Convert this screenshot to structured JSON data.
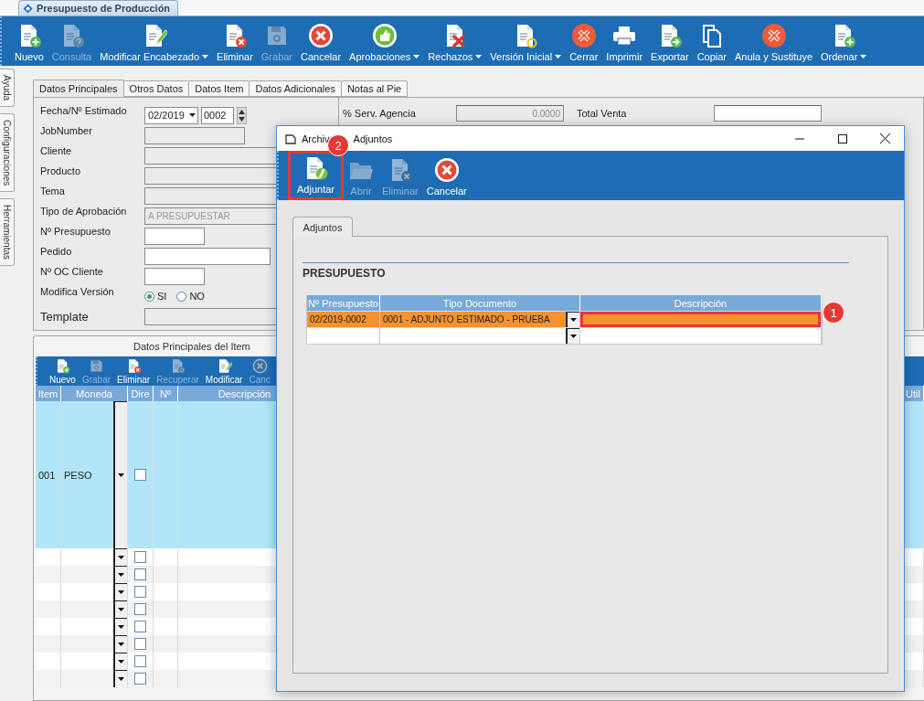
{
  "document_tab": {
    "title": "Presupuesto de Producción"
  },
  "toolbar": [
    {
      "label": "Nuevo",
      "disabled": false,
      "dropdown": false
    },
    {
      "label": "Consulta",
      "disabled": true,
      "dropdown": false
    },
    {
      "label": "Modificar Encabezado",
      "disabled": false,
      "dropdown": true
    },
    {
      "label": "Eliminar",
      "disabled": false,
      "dropdown": false
    },
    {
      "label": "Grabar",
      "disabled": true,
      "dropdown": false
    },
    {
      "label": "Cancelar",
      "disabled": false,
      "dropdown": false
    },
    {
      "label": "Aprobaciones",
      "disabled": false,
      "dropdown": true
    },
    {
      "label": "Rechazos",
      "disabled": false,
      "dropdown": true
    },
    {
      "label": "Versión Inicial",
      "disabled": false,
      "dropdown": true
    },
    {
      "label": "Cerrar",
      "disabled": false,
      "dropdown": false
    },
    {
      "label": "Imprimir",
      "disabled": false,
      "dropdown": false
    },
    {
      "label": "Exportar",
      "disabled": false,
      "dropdown": false
    },
    {
      "label": "Copiar",
      "disabled": false,
      "dropdown": false
    },
    {
      "label": "Anula y Sustituye",
      "disabled": false,
      "dropdown": false
    },
    {
      "label": "Ordenar",
      "disabled": false,
      "dropdown": true
    }
  ],
  "side_tabs": [
    "Ayuda",
    "Configuraciones",
    "Herramientas"
  ],
  "form_tabs": [
    {
      "label": "Datos Principales",
      "selected": true
    },
    {
      "label": "Otros Datos",
      "selected": false
    },
    {
      "label": "Datos Item",
      "selected": false
    },
    {
      "label": "Datos Adicionales",
      "selected": false
    },
    {
      "label": "Notas al Pie",
      "selected": false
    }
  ],
  "form": {
    "fields": [
      {
        "kind": "date",
        "label": "Fecha/Nº Estimado",
        "period": "02/2019",
        "number": "0002"
      },
      {
        "kind": "text",
        "label": "JobNumber",
        "disabled": true
      },
      {
        "kind": "text",
        "label": "Cliente",
        "disabled": true
      },
      {
        "kind": "text",
        "label": "Producto",
        "disabled": true
      },
      {
        "kind": "text",
        "label": "Tema",
        "disabled": true
      },
      {
        "kind": "text",
        "label": "Tipo de Aprobación",
        "value": "A PRESUPUESTAR",
        "disabled": true
      },
      {
        "kind": "text",
        "label": "Nº Presupuesto",
        "disabled": false
      },
      {
        "kind": "text",
        "label": "Pedido",
        "disabled": false
      },
      {
        "kind": "text",
        "label": "Nº OC Cliente",
        "disabled": false
      },
      {
        "kind": "radio",
        "label": "Modifica Versión",
        "options": [
          {
            "label": "SI",
            "selected": true
          },
          {
            "label": "NO",
            "selected": false
          }
        ]
      },
      {
        "kind": "text",
        "label": "Template",
        "disabled": true
      }
    ],
    "totals": [
      {
        "label": "% Serv. Agencia",
        "value": "0.0000",
        "disabled": true
      },
      {
        "label": "Total Venta",
        "disabled": false
      }
    ]
  },
  "item_panel": {
    "title": "Datos Principales del Item",
    "toolbar": [
      {
        "label": "Nuevo",
        "disabled": false
      },
      {
        "label": "Grabar",
        "disabled": true
      },
      {
        "label": "Eliminar",
        "disabled": false
      },
      {
        "label": "Recuperar",
        "disabled": true
      },
      {
        "label": "Modificar",
        "disabled": false
      },
      {
        "label": "Canc",
        "disabled": true
      }
    ],
    "columns": [
      "Item",
      "Moneda",
      "Dire",
      "Nº",
      "Descripción",
      "Util"
    ],
    "rows": [
      {
        "item": "001",
        "moneda": "PESO",
        "dire": false,
        "selected": true
      },
      {
        "dire": false,
        "selected": false
      },
      {
        "dire": false,
        "selected": false
      },
      {
        "dire": false,
        "selected": false
      },
      {
        "dire": false,
        "selected": false
      },
      {
        "dire": false,
        "selected": false
      },
      {
        "dire": false,
        "selected": false
      },
      {
        "dire": false,
        "selected": false
      },
      {
        "dire": false,
        "selected": false
      }
    ]
  },
  "dialog": {
    "title": [
      "Archiv",
      "Adjuntos"
    ],
    "toolbar": [
      {
        "label": "Adjuntar",
        "disabled": false,
        "highlighted": true
      },
      {
        "label": "Abrir",
        "disabled": true,
        "highlighted": false
      },
      {
        "label": "Eliminar",
        "disabled": true,
        "highlighted": false
      },
      {
        "label": "Cancelar",
        "disabled": false,
        "highlighted": false
      }
    ],
    "tabs": [
      {
        "label": "Adjuntos",
        "selected": true
      }
    ],
    "section": "PRESUPUESTO",
    "columns": [
      "Nº Presupuesto",
      "Tipo Documento",
      "Descripción"
    ],
    "rows": [
      {
        "presupuesto": "02/2019-0002",
        "tipo": "0001 - ADJUNTO ESTIMADO - PRUEBA",
        "selected": true,
        "highlighted": true
      },
      {
        "selected": false,
        "highlighted": false
      }
    ]
  },
  "callouts": [
    {
      "number": "2"
    },
    {
      "number": "1"
    }
  ]
}
